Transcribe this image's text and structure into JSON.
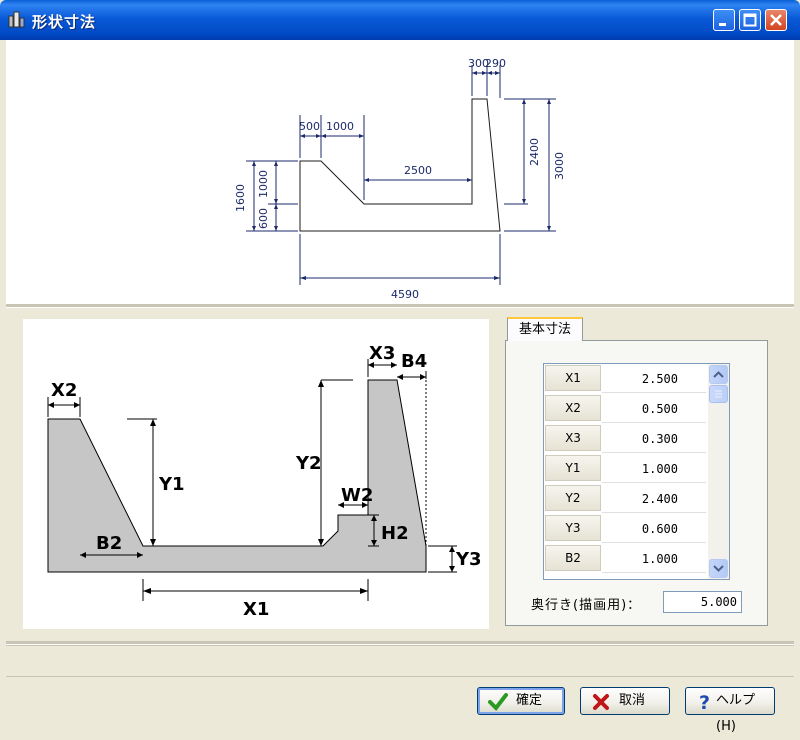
{
  "window": {
    "title": "形状寸法"
  },
  "preview": {
    "dims": {
      "d500": "500",
      "d1000_top": "1000",
      "d2500": "2500",
      "d300": "300",
      "d290": "290",
      "d2400": "2400",
      "d3000": "3000",
      "d1600": "1600",
      "d1000_left": "1000",
      "d600": "600",
      "d4590": "4590"
    }
  },
  "diagram": {
    "labels": {
      "x1": "X1",
      "x2": "X2",
      "x3": "X3",
      "y1": "Y1",
      "y2": "Y2",
      "y3": "Y3",
      "b2": "B2",
      "b4": "B4",
      "w2": "W2",
      "h2": "H2"
    }
  },
  "params": {
    "tab_label": "基本寸法",
    "rows": [
      {
        "name": "X1",
        "value": "2.500"
      },
      {
        "name": "X2",
        "value": "0.500"
      },
      {
        "name": "X3",
        "value": "0.300"
      },
      {
        "name": "Y1",
        "value": "1.000"
      },
      {
        "name": "Y2",
        "value": "2.400"
      },
      {
        "name": "Y3",
        "value": "0.600"
      },
      {
        "name": "B2",
        "value": "1.000"
      }
    ],
    "depth_label": "奥行き(描画用)：",
    "depth_value": "5.000"
  },
  "buttons": {
    "ok": "確定",
    "cancel": "取消",
    "help": "ヘルプ(H)"
  }
}
